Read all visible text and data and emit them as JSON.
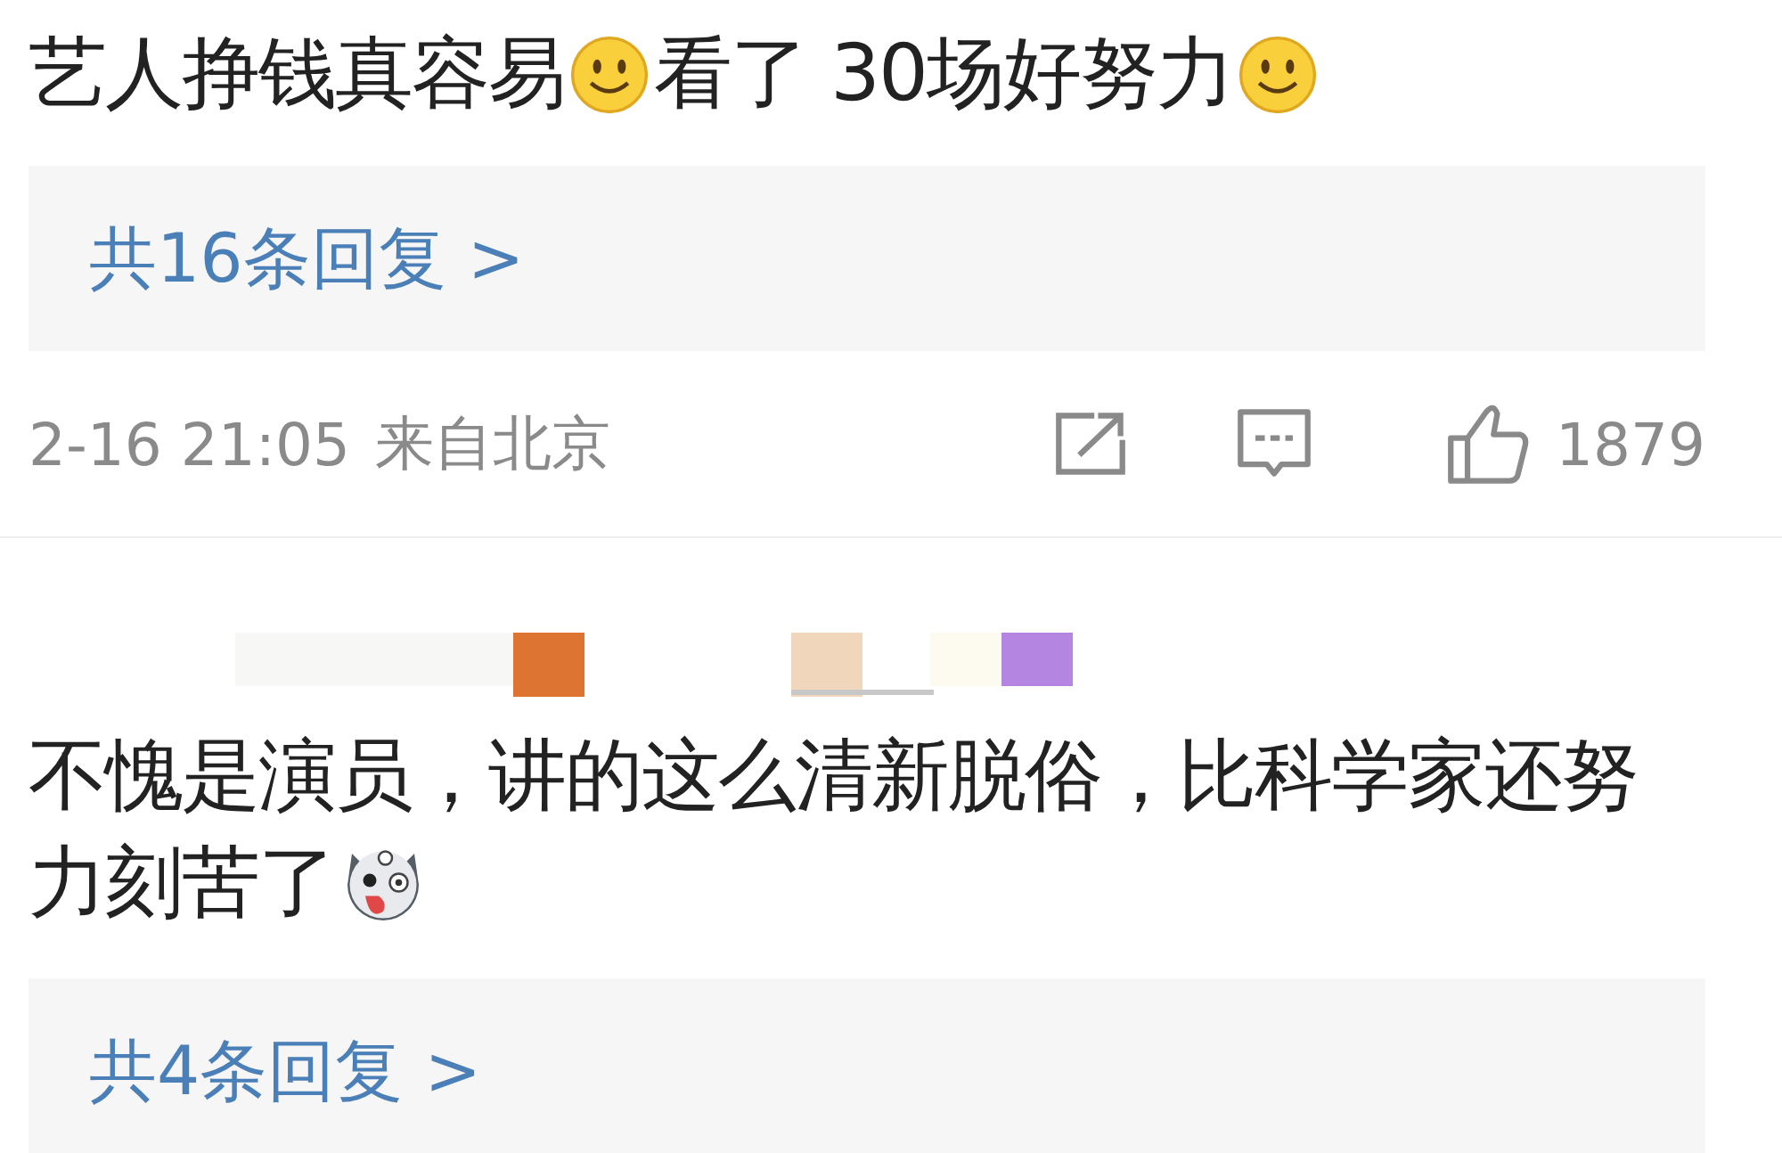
{
  "comments": [
    {
      "content": [
        {
          "kind": "text",
          "text": "艺人挣钱真容易"
        },
        {
          "kind": "smile"
        },
        {
          "kind": "text",
          "text": "看了 30场好努力"
        },
        {
          "kind": "smile"
        }
      ],
      "replies": "共16条回复 >",
      "meta": {
        "time": "2-16 21:05",
        "location": "来自北京",
        "likes": "1879"
      }
    },
    {
      "redacted_author": true,
      "content": [
        {
          "kind": "text",
          "text": "不愧是演员，讲的这么清新脱俗，比科学家还努力刻苦了"
        },
        {
          "kind": "husky"
        }
      ],
      "replies": "共4条回复 >"
    }
  ]
}
